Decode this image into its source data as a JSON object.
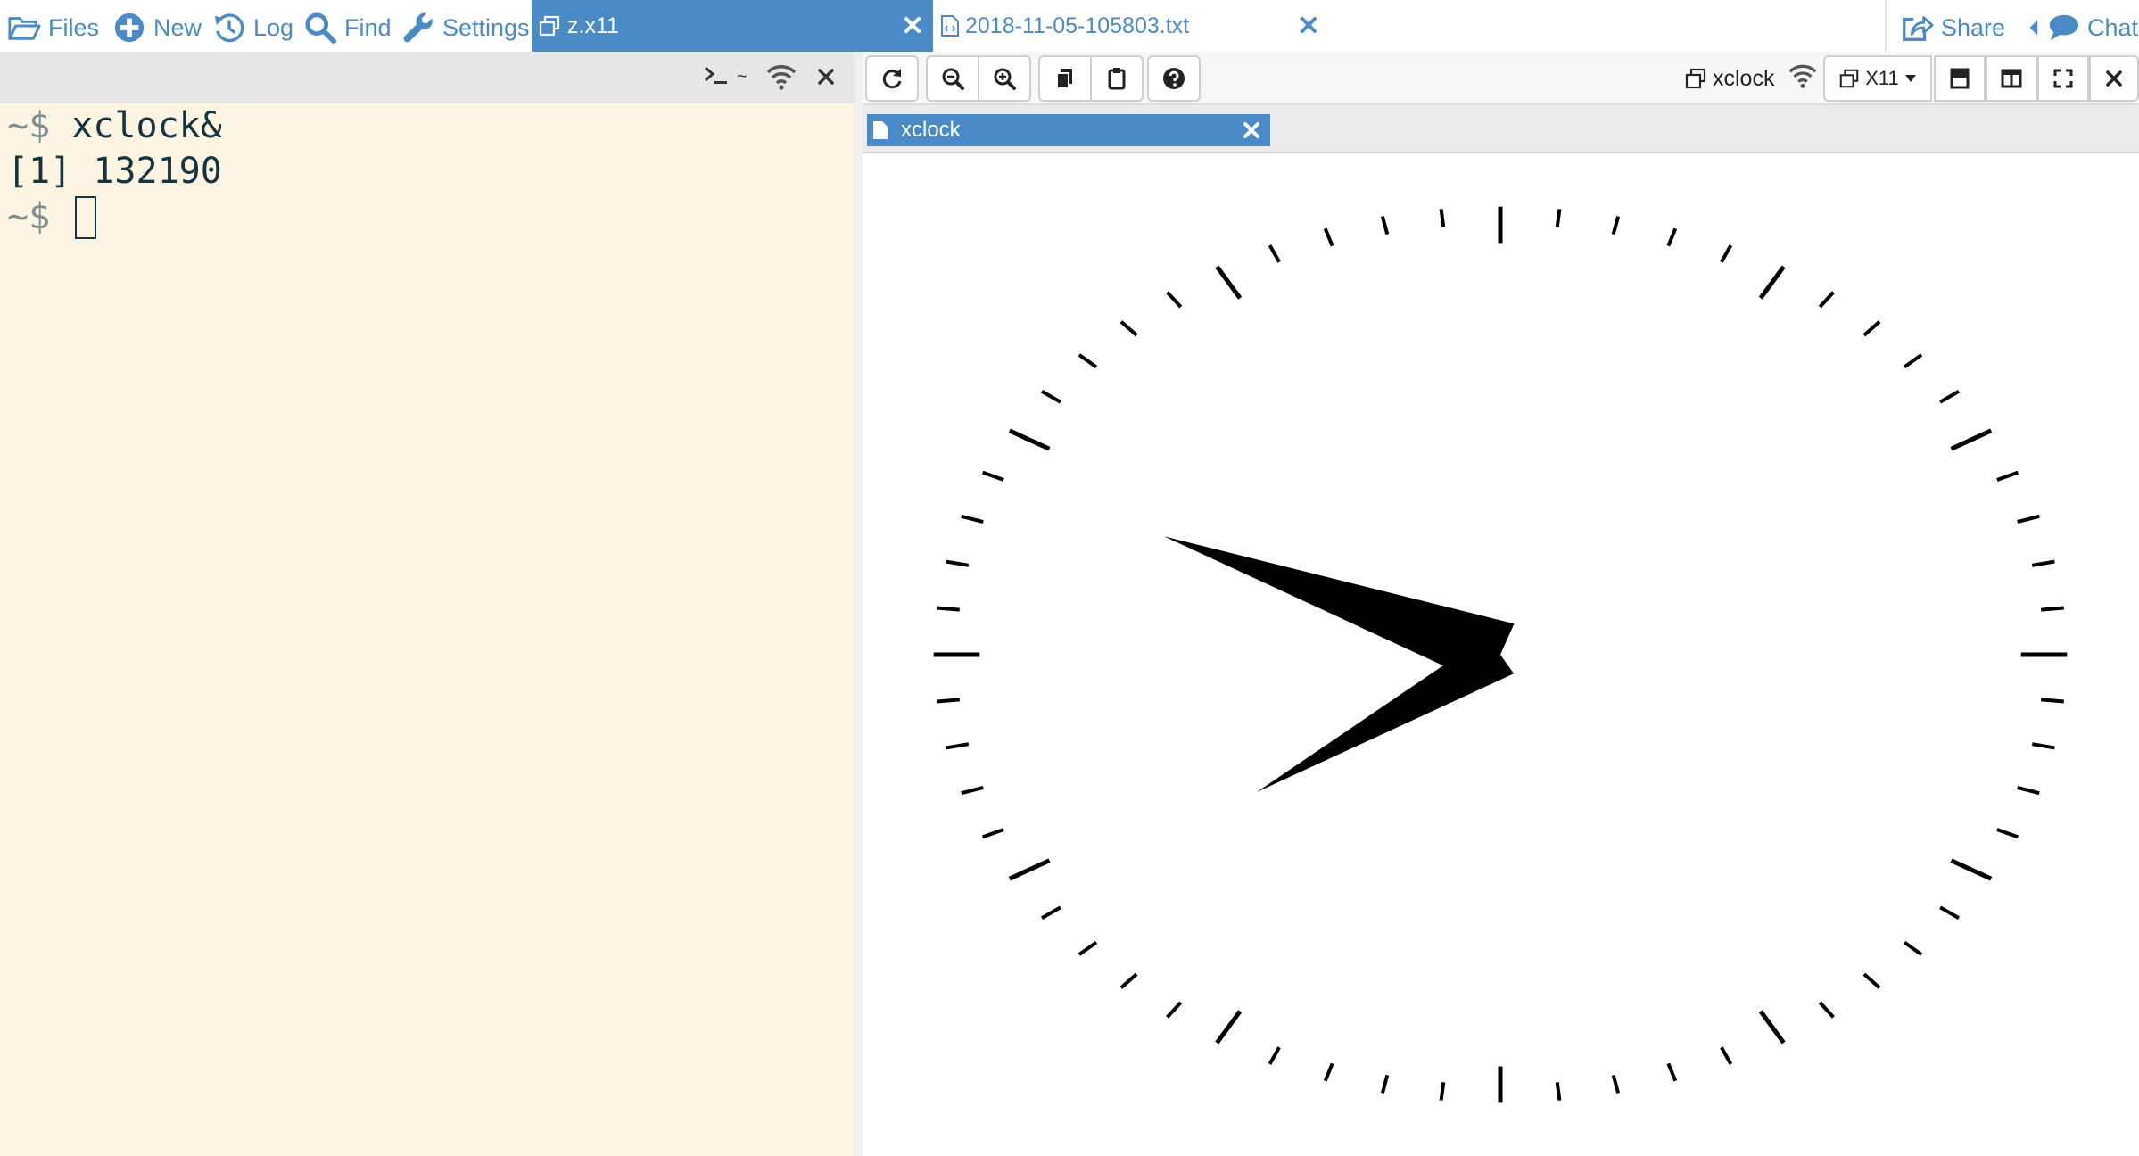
{
  "topbar": {
    "files": "Files",
    "new": "New",
    "log": "Log",
    "find": "Find",
    "settings": "Settings",
    "share": "Share",
    "chat": "Chat"
  },
  "tabs": [
    {
      "label": "z.x11",
      "active": true
    },
    {
      "label": "2018-11-05-105803.txt",
      "active": false
    }
  ],
  "terminal": {
    "header_label": "~",
    "prompt": "~$",
    "lines": [
      {
        "prompt": "~$",
        "text": " xclock&"
      },
      {
        "prompt": "",
        "text": "[1] 132190"
      },
      {
        "prompt": "~$",
        "text": " "
      }
    ]
  },
  "viewer": {
    "window_title": "xclock",
    "display_select": "X11",
    "window_tab": "xclock"
  },
  "clock": {
    "time": {
      "hour": 7,
      "minute": 49
    }
  },
  "colors": {
    "accent": "#4a8bc7",
    "terminal_bg": "#fdf5e2",
    "terminal_text": "#14343f"
  }
}
